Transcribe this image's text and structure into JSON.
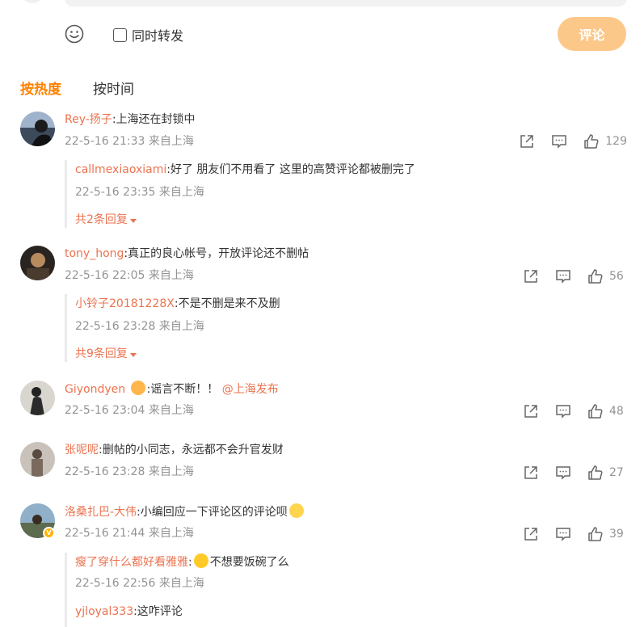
{
  "composer": {
    "repost_label": "同时转发",
    "submit_label": "评论"
  },
  "sort": {
    "hot_label": "按热度",
    "time_label": "按时间"
  },
  "comments": [
    {
      "user": "Rey-扬子",
      "text": ":上海还在封锁中",
      "meta": "22-5-16 21:33 来自上海",
      "likes": "129",
      "replies": [
        {
          "user": "callmexiaoxiami",
          "text": ":好了 朋友们不用看了 这里的高赞评论都被删完了",
          "meta": "22-5-16 23:35 来自上海"
        }
      ],
      "more": "共2条回复"
    },
    {
      "user": "tony_hong",
      "text": ":真正的良心帐号，开放评论还不删帖",
      "meta": "22-5-16 22:05 来自上海",
      "likes": "56",
      "replies": [
        {
          "user": "小铃子20181228X",
          "text": ":不是不删是来不及删",
          "meta": "22-5-16 23:28 来自上海"
        }
      ],
      "more": "共9条回复"
    },
    {
      "user": "Giyondyen",
      "text": ":谣言不断！！",
      "mention": "@上海发布",
      "meta": "22-5-16 23:04 来自上海",
      "likes": "48"
    },
    {
      "user": "张呢呢",
      "text": ":删帖的小同志，永远都不会升官发财",
      "meta": "22-5-16 23:28 来自上海",
      "likes": "27"
    },
    {
      "user": "洛桑扎巴-大伟",
      "text": ":小编回应一下评论区的评论呗",
      "meta": "22-5-16 21:44 来自上海",
      "likes": "39",
      "replies": [
        {
          "user": "瘦了穿什么都好看雅雅",
          "text": "不想要饭碗了么",
          "meta": "22-5-16 22:56 来自上海"
        },
        {
          "user": "yjloyal333",
          "text": ":这咋评论",
          "meta": ""
        }
      ]
    }
  ],
  "colors": {
    "accent": "#ff8200",
    "username": "#eb7350",
    "meta": "#939393",
    "submit_bg": "#fcc88a"
  }
}
